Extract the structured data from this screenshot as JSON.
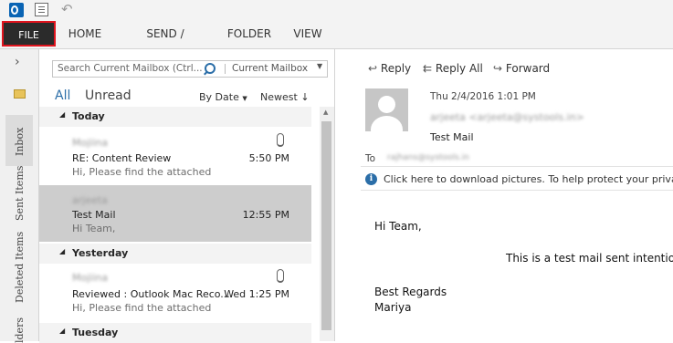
{
  "ribbon": {
    "tabs": [
      "FILE",
      "HOME",
      "SEND / RECEIVE",
      "FOLDER",
      "VIEW"
    ]
  },
  "leftnav": {
    "expand_glyph": "›",
    "folders": [
      "Inbox",
      "Sent Items",
      "Deleted Items",
      "lders"
    ]
  },
  "list": {
    "search_placeholder": "Search Current Mailbox (Ctrl...",
    "scope": "Current Mailbox",
    "filter_all": "All",
    "filter_unread": "Unread",
    "sort_by": "By Date",
    "order": "Newest",
    "groups": {
      "today": "Today",
      "yesterday": "Yesterday",
      "tuesday": "Tuesday"
    },
    "mails": [
      {
        "sender": "Mojiina",
        "subject": "RE: Content Review",
        "preview": "Hi,  Please find the attached",
        "time": "5:50 PM",
        "attachment": true,
        "selected": false
      },
      {
        "sender": "arjeeta",
        "subject": "Test Mail",
        "preview": "Hi Team,",
        "time": "12:55 PM",
        "attachment": false,
        "selected": true
      },
      {
        "sender": "Mojiina",
        "subject": "Reviewed : Outlook Mac Reco...",
        "preview": "Hi,  Please find the attached",
        "time": "Wed 1:25 PM",
        "attachment": true,
        "selected": false
      }
    ]
  },
  "reading": {
    "actions": {
      "reply": "Reply",
      "reply_all": "Reply All",
      "forward": "Forward"
    },
    "date": "Thu 2/4/2016 1:01 PM",
    "from": "arjeeta <arjeeta@systools.in>",
    "subject": "Test Mail",
    "to_label": "To",
    "to_value": "rajhans@systools.in",
    "info_bar": "Click here to download pictures. To help protect your privacy,",
    "body": {
      "greeting": "Hi Team,",
      "line": "This is a test mail sent intentio",
      "closing": "Best Regards",
      "name": "Mariya"
    }
  },
  "colors": {
    "accent": "#2b6ea8",
    "file_tab_bg": "#2b2b2b",
    "file_tab_border": "#e0141e",
    "selected_row": "#cdcdcd"
  }
}
